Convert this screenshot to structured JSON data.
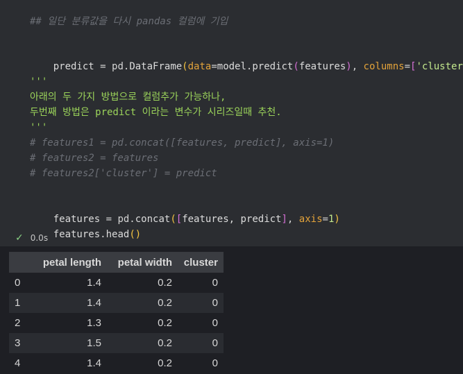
{
  "code_lines": {
    "l0": "## 일단 분류값을 다시 pandas 컬럼에 기입",
    "l1": [
      "predict",
      " = pd.",
      "DataFrame",
      "(",
      "data",
      "=",
      "model",
      ".",
      "predict",
      "(",
      "features",
      ")",
      ", ",
      "columns",
      "=",
      "[",
      "'cluster'",
      "]",
      ")"
    ],
    "l2": "'''",
    "l3": "아래의 두 가지 방법으로 컬럼추가 가능하나,",
    "l4": "두번째 방법은 predict 이라는 변수가 시리즈일때 추천.",
    "l5": "'''",
    "l6": "# features1 = pd.concat([features, predict], axis=1)",
    "l7": "# features2 = features",
    "l8": "# features2['cluster'] = predict",
    "l9": [
      "features",
      " = pd.",
      "concat",
      "(",
      "[",
      "features, predict",
      "]",
      ", ",
      "axis",
      "=",
      "1",
      ")"
    ],
    "l10": [
      "features",
      ".",
      "head",
      "(",
      ")"
    ]
  },
  "status": {
    "time": "0.0s"
  },
  "table": {
    "columns": [
      "",
      "petal length",
      "petal width",
      "cluster"
    ],
    "rows": [
      [
        "0",
        "1.4",
        "0.2",
        "0"
      ],
      [
        "1",
        "1.4",
        "0.2",
        "0"
      ],
      [
        "2",
        "1.3",
        "0.2",
        "0"
      ],
      [
        "3",
        "1.5",
        "0.2",
        "0"
      ],
      [
        "4",
        "1.4",
        "0.2",
        "0"
      ]
    ]
  }
}
